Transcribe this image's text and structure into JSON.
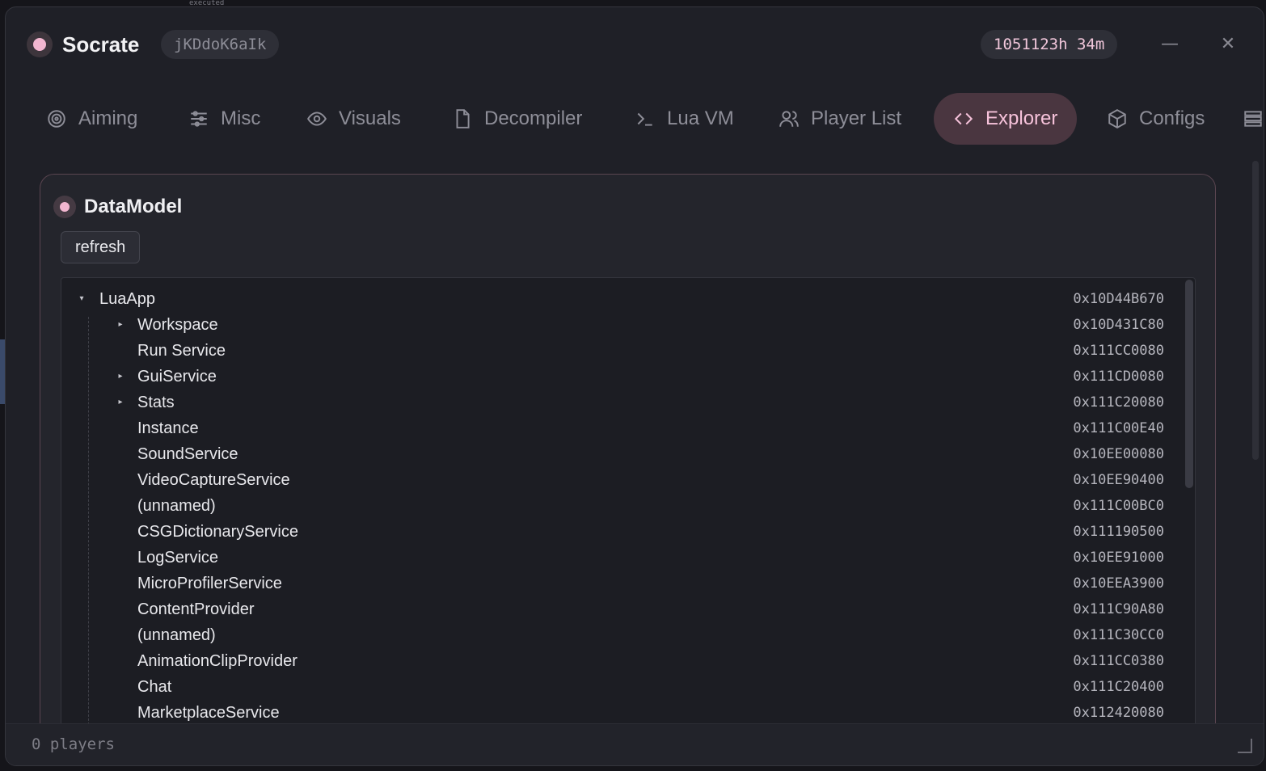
{
  "window": {
    "title": "Socrate",
    "session_id": "jKDdoK6aIk",
    "uptime": "1051123h 34m",
    "minimize_label": "—",
    "close_label": "✕"
  },
  "tabs": [
    {
      "label": "Aiming",
      "icon": "crosshair-icon"
    },
    {
      "label": "Misc",
      "icon": "sliders-icon"
    },
    {
      "label": "Visuals",
      "icon": "eye-icon"
    },
    {
      "label": "Decompiler",
      "icon": "file-icon"
    },
    {
      "label": "Lua VM",
      "icon": "terminal-icon"
    },
    {
      "label": "Player List",
      "icon": "users-icon"
    },
    {
      "label": "Explorer",
      "icon": "code-icon",
      "active": true
    },
    {
      "label": "Configs",
      "icon": "box-icon"
    }
  ],
  "panel": {
    "title": "DataModel",
    "refresh_label": "refresh"
  },
  "tree": [
    {
      "name": "LuaApp",
      "address": "0x10D44B670",
      "depth": 0,
      "caret": "▾"
    },
    {
      "name": "Workspace",
      "address": "0x10D431C80",
      "depth": 1,
      "caret": "▸"
    },
    {
      "name": "Run Service",
      "address": "0x111CC0080",
      "depth": 1,
      "caret": ""
    },
    {
      "name": "GuiService",
      "address": "0x111CD0080",
      "depth": 1,
      "caret": "▸"
    },
    {
      "name": "Stats",
      "address": "0x111C20080",
      "depth": 1,
      "caret": "▸"
    },
    {
      "name": "Instance",
      "address": "0x111C00E40",
      "depth": 1,
      "caret": ""
    },
    {
      "name": "SoundService",
      "address": "0x10EE00080",
      "depth": 1,
      "caret": ""
    },
    {
      "name": "VideoCaptureService",
      "address": "0x10EE90400",
      "depth": 1,
      "caret": ""
    },
    {
      "name": "(unnamed)",
      "address": "0x111C00BC0",
      "depth": 1,
      "caret": ""
    },
    {
      "name": "CSGDictionaryService",
      "address": "0x111190500",
      "depth": 1,
      "caret": ""
    },
    {
      "name": "LogService",
      "address": "0x10EE91000",
      "depth": 1,
      "caret": ""
    },
    {
      "name": "MicroProfilerService",
      "address": "0x10EEA3900",
      "depth": 1,
      "caret": ""
    },
    {
      "name": "ContentProvider",
      "address": "0x111C90A80",
      "depth": 1,
      "caret": ""
    },
    {
      "name": "(unnamed)",
      "address": "0x111C30CC0",
      "depth": 1,
      "caret": ""
    },
    {
      "name": "AnimationClipProvider",
      "address": "0x111CC0380",
      "depth": 1,
      "caret": ""
    },
    {
      "name": "Chat",
      "address": "0x111C20400",
      "depth": 1,
      "caret": ""
    },
    {
      "name": "MarketplaceService",
      "address": "0x112420080",
      "depth": 1,
      "caret": ""
    }
  ],
  "footer": {
    "status": "0 players"
  },
  "background": {
    "top_text": "executed"
  },
  "colors": {
    "accent": "#f6c2da",
    "active_tab_bg": "#4a3640",
    "window_bg": "#1f2027"
  }
}
